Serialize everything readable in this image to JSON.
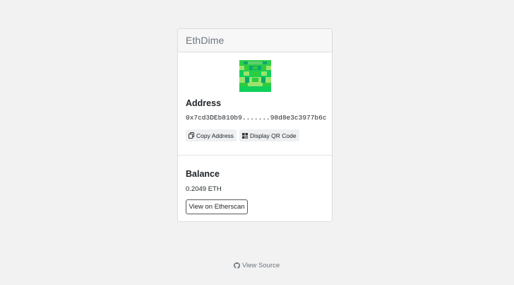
{
  "app": {
    "title": "EthDime"
  },
  "identicon": {
    "colors": [
      "#2ecc40",
      "#9be36c",
      "#0aa86a"
    ]
  },
  "address": {
    "heading": "Address",
    "value": "0x7cd3DEb810b9.......98d8e3c3977b6c",
    "copy_label": "Copy Address",
    "copy_icon": "copy-icon",
    "qr_label": "Display QR Code",
    "qr_icon": "qr-code-icon"
  },
  "balance": {
    "heading": "Balance",
    "value": "0.2049 ETH",
    "etherscan_label": "View on Etherscan"
  },
  "footer": {
    "source_label": "View Source",
    "source_icon": "github-icon"
  }
}
